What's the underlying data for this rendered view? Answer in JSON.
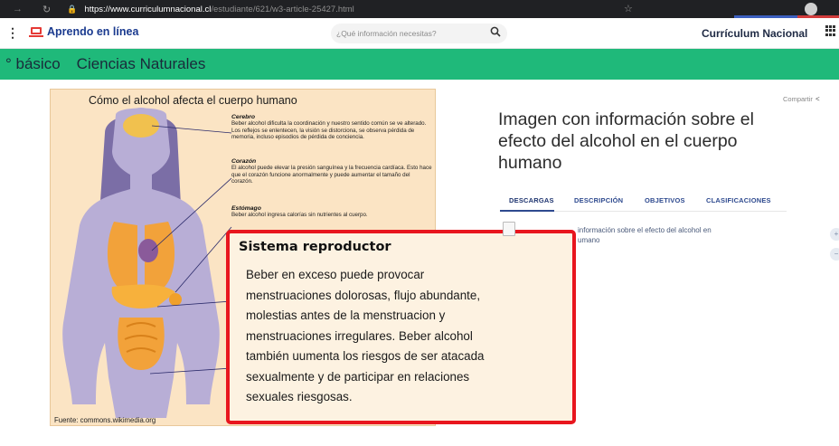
{
  "browser": {
    "url_host": "https://www.curriculumnacional.cl",
    "url_path": "/estudiante/621/w3-article-25427.html"
  },
  "header": {
    "brand": "Aprendo en línea",
    "search_placeholder": "¿Qué información necesitas?",
    "site_name": "Currículum Nacional"
  },
  "band": {
    "level": "° básico",
    "subject": "Ciencias Naturales"
  },
  "infographic": {
    "title": "Cómo el alcohol afecta el cuerpo humano",
    "sections": [
      {
        "heading": "Cerebro",
        "text": "Beber alcohol dificulta la coordinación y nuestro sentido común se ve alterado. Los reflejos se enlentecen, la visión se distorciona, se observa pérdida de memoria, incluso episodios de pérdida de conciencia."
      },
      {
        "heading": "Corazón",
        "text": "El alcohol puede elevar la presión sanguínea y la frecuencia cardíaca. Esto hace que el corazón funcione anormalmente y puede aumentar el tamaño del corazón."
      },
      {
        "heading": "Estómago",
        "text": "Beber alcohol ingresa calorías sin nutrientes al cuerpo."
      }
    ],
    "source": "Fuente: commons.wikimedia.org"
  },
  "popup": {
    "title": "Sistema reproductor",
    "lines": [
      "Beber en exceso puede provocar",
      "menstruaciones dolorosas, flujo abundante,",
      "molestias antes de la menstruacion y",
      "menstruaciones irregulares.  Beber alcohol",
      "también uumenta los riesgos de ser atacada",
      "sexualmente y de participar en relaciones",
      "sexuales riesgosas."
    ]
  },
  "article": {
    "share": "Compartir",
    "title": "Imagen con información sobre el efecto del alcohol en el cuerpo humano",
    "tabs": [
      "DESCARGAS",
      "DESCRIPCIÓN",
      "OBJETIVOS",
      "CLASIFICACIONES"
    ],
    "download_line1": "información sobre el efecto del alcohol en",
    "download_line2": "umano"
  },
  "colors": {
    "band": "#1fb97a",
    "brand_text": "#1a3a8f",
    "popup_border": "#e8161e",
    "tab_text": "#2e4a8f"
  },
  "icons": {
    "brand": "laptop-icon",
    "search": "search-icon",
    "apps": "grid-icon",
    "share": "share-icon"
  }
}
